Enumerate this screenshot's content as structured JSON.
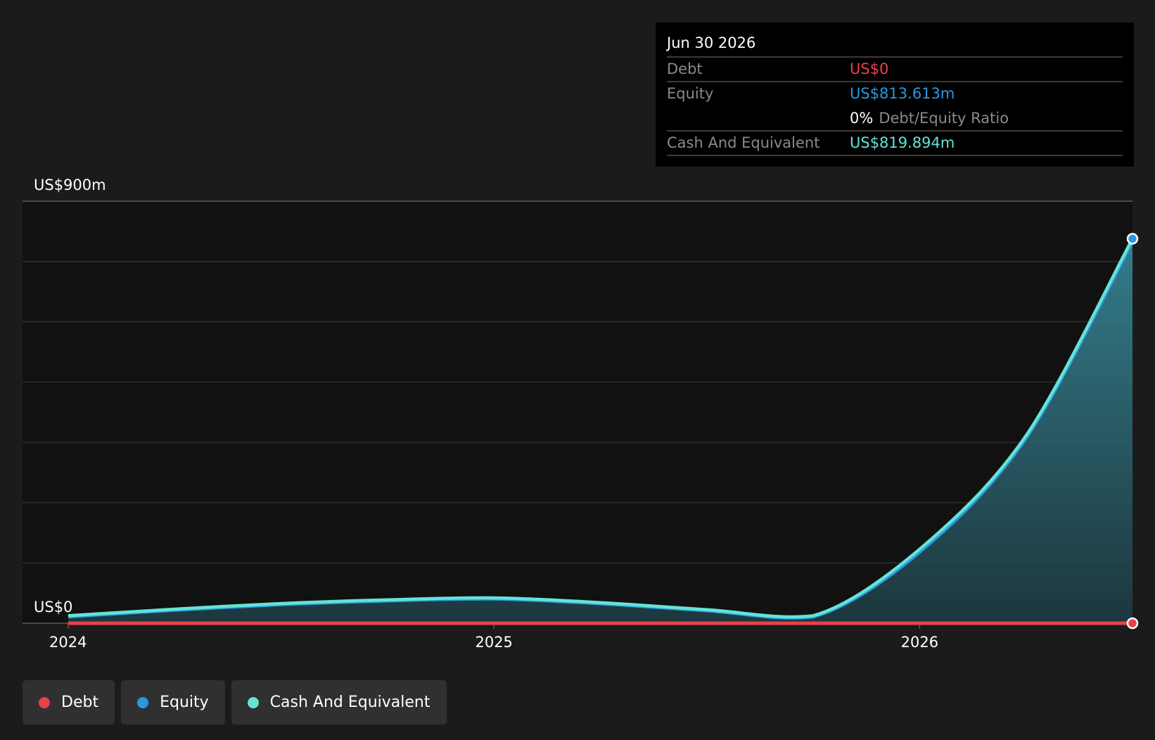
{
  "tooltip": {
    "date": "Jun 30 2026",
    "debt_label": "Debt",
    "debt_value": "US$0",
    "equity_label": "Equity",
    "equity_value": "US$813.613m",
    "ratio_value": "0%",
    "ratio_label": "Debt/Equity Ratio",
    "cash_label": "Cash And Equivalent",
    "cash_value": "US$819.894m"
  },
  "legend": [
    {
      "label": "Debt",
      "color": "#e8414a"
    },
    {
      "label": "Equity",
      "color": "#2a97e0"
    },
    {
      "label": "Cash And Equivalent",
      "color": "#64e4d4"
    }
  ],
  "chart_data": {
    "type": "area",
    "ylim": [
      0,
      900
    ],
    "ytick_labels": [
      "US$0",
      "US$900m"
    ],
    "xtick_labels": [
      "2024",
      "2025",
      "2026"
    ],
    "xtick_values": [
      2024.0,
      2025.0,
      2026.0
    ],
    "xlim": [
      2024.0,
      2026.5
    ],
    "grid": true,
    "legend_position": "bottom-left",
    "series": [
      {
        "name": "Debt",
        "color": "#e8414a",
        "x": [
          2024.0,
          2024.25,
          2024.5,
          2024.75,
          2025.0,
          2025.25,
          2025.5,
          2025.75,
          2026.0,
          2026.25,
          2026.5
        ],
        "y": [
          0,
          0,
          0,
          0,
          0,
          0,
          0,
          0,
          0,
          0,
          0
        ]
      },
      {
        "name": "Equity",
        "color": "#2a97e0",
        "x": [
          2024.0,
          2024.25,
          2024.5,
          2024.75,
          2025.0,
          2025.25,
          2025.5,
          2025.75,
          2026.0,
          2026.25,
          2026.5
        ],
        "y": [
          14,
          28,
          40,
          48,
          52,
          42,
          27,
          14,
          152,
          395,
          813.613
        ]
      },
      {
        "name": "Cash And Equivalent",
        "color": "#64e4d4",
        "x": [
          2024.0,
          2024.25,
          2024.5,
          2024.75,
          2025.0,
          2025.25,
          2025.5,
          2025.75,
          2026.0,
          2026.25,
          2026.5
        ],
        "y": [
          16,
          30,
          42,
          50,
          54,
          44,
          29,
          16,
          158,
          400,
          819.894
        ]
      }
    ]
  }
}
